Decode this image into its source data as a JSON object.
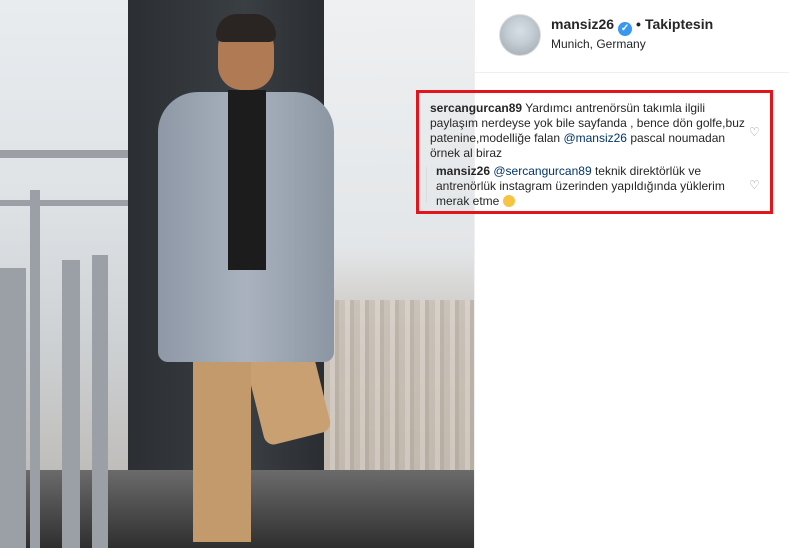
{
  "post": {
    "username": "mansiz26",
    "follow_status": "Takiptesin",
    "location": "Munich, Germany"
  },
  "comments": [
    {
      "user": "sercangurcan89",
      "text_before": "Yardımcı antrenörsün takımla ilgili paylaşım nerdeyse yok bile sayfanda , bence dön golfe,buz patenine,modelliğe falan ",
      "mention": "@mansiz26",
      "text_after": " pascal noumadan örnek al biraz"
    },
    {
      "user": "mansiz26",
      "mention": "@sercangurcan89",
      "text_after": " teknik direktörlük ve antrenörlük instagram üzerinden yapıldığında yüklerim merak etme "
    }
  ],
  "icons": {
    "verified": "verified-badge-icon",
    "heart": "heart-outline-icon",
    "emoji": "smirk-emoji-icon"
  },
  "colors": {
    "highlight": "#e3141b",
    "verified": "#3897f0",
    "mention": "#003569"
  }
}
